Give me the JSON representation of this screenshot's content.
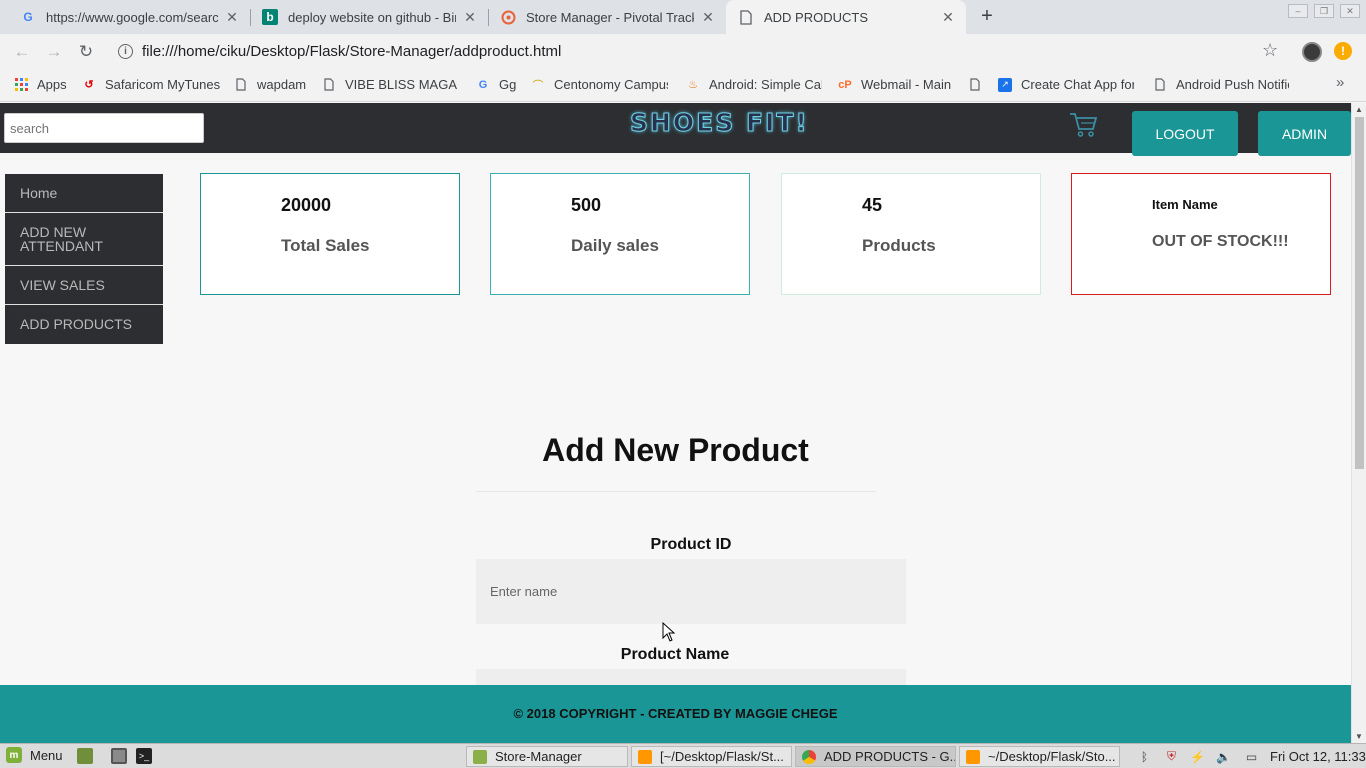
{
  "browser": {
    "tabs": [
      {
        "title": "https://www.google.com/search",
        "icon": "google-icon"
      },
      {
        "title": "deploy website on github - Bing",
        "icon": "bing-icon"
      },
      {
        "title": "Store Manager - Pivotal Tracker",
        "icon": "pivotal-icon"
      },
      {
        "title": "ADD PRODUCTS",
        "icon": "page-icon"
      }
    ],
    "url": "file:///home/ciku/Desktop/Flask/Store-Manager/addproduct.html",
    "bookmarks": [
      {
        "label": "Apps",
        "icon": "apps-icon"
      },
      {
        "label": "Safaricom MyTunes",
        "icon": "safaricom-icon"
      },
      {
        "label": "wapdam",
        "icon": "page-icon"
      },
      {
        "label": "VIBE BLISS MAGAZINE",
        "icon": "page-icon"
      },
      {
        "label": "Gg",
        "icon": "google-icon"
      },
      {
        "label": "Centonomy Campus",
        "icon": "centonomy-icon"
      },
      {
        "label": "Android: Simple Calc",
        "icon": "java-icon"
      },
      {
        "label": "Webmail - Main",
        "icon": "cpanel-icon"
      },
      {
        "label": "",
        "icon": "page-icon"
      },
      {
        "label": "Create Chat App for",
        "icon": "link-icon"
      },
      {
        "label": "Android Push Notific",
        "icon": "page-icon"
      }
    ]
  },
  "site": {
    "search_placeholder": "search",
    "logo_text": "SHOES FIT!",
    "logout_label": "LOGOUT",
    "admin_label": "ADMIN",
    "nav": [
      {
        "label": "Home"
      },
      {
        "label": "ADD NEW ATTENDANT"
      },
      {
        "label": "VIEW SALES"
      },
      {
        "label": "ADD PRODUCTS"
      }
    ],
    "stats": [
      {
        "value": "20000",
        "label": "Total Sales",
        "border": "#1b9696"
      },
      {
        "value": "500",
        "label": "Daily sales",
        "border": "#3bb0b0"
      },
      {
        "value": "45",
        "label": "Products",
        "border": "#cdeedd"
      },
      {
        "value": "Item Name",
        "label": "OUT OF STOCK!!!",
        "border": "#d81c1c"
      }
    ],
    "form": {
      "title": "Add New Product",
      "fields": [
        {
          "label": "Product ID",
          "placeholder": "Enter name"
        },
        {
          "label": "Product Name",
          "placeholder": ""
        }
      ]
    },
    "footer": "© 2018 COPYRIGHT - CREATED BY MAGGIE CHEGE",
    "accent_color": "#1b9696"
  },
  "taskbar": {
    "menu_label": "Menu",
    "windows": [
      {
        "label": "Store-Manager",
        "icon": "folder-icon"
      },
      {
        "label": "[~/Desktop/Flask/St...",
        "icon": "sublime-icon"
      },
      {
        "label": "ADD PRODUCTS - G...",
        "icon": "chrome-icon"
      },
      {
        "label": "~/Desktop/Flask/Sto...",
        "icon": "sublime-icon"
      }
    ],
    "clock": "Fri Oct 12, 11:33"
  }
}
